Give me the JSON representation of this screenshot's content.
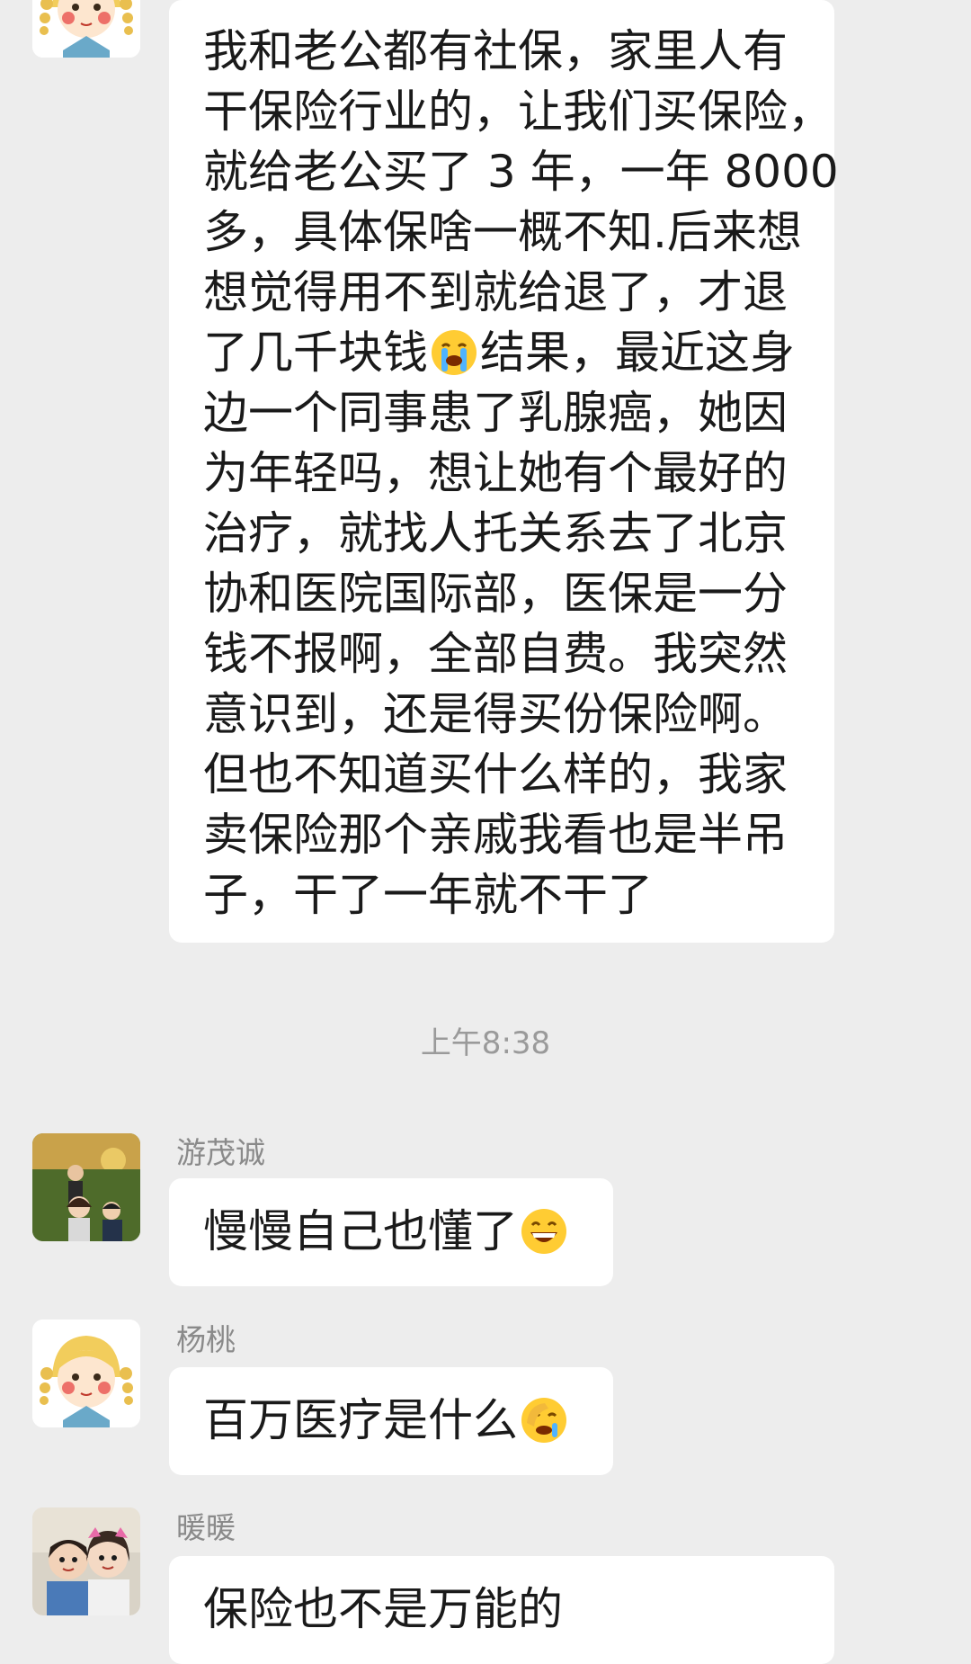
{
  "messages": [
    {
      "sender": "",
      "avatar": "cartoon-girl-avatar",
      "lines": [
        "我和老公都有社保，家里人有",
        "干保险行业的，让我们买保险，",
        "就给老公买了 3 年，一年 8000",
        "多，具体保啥一概不知.后来想",
        "想觉得用不到就给退了，才退",
        "了几千块钱",
        "边一个同事患了乳腺癌，她因",
        "为年轻吗，想让她有个最好的",
        "治疗，就找人托关系去了北京",
        "协和医院国际部，医保是一分",
        "钱不报啊，全部自费。我突然",
        "意识到，还是得买份保险啊。",
        "但也不知道买什么样的，我家",
        "卖保险那个亲戚我看也是半吊",
        "子，干了一年就不干了"
      ],
      "line6_after_emoji": "结果，最近这身",
      "emoji": "loudly-crying-face"
    },
    {
      "sender": "游茂诚",
      "avatar": "family-photo-avatar",
      "text": "慢慢自己也懂了",
      "emoji": "grinning-face"
    },
    {
      "sender": "杨桃",
      "avatar": "cartoon-girl-avatar",
      "text": "百万医疗是什么",
      "emoji": "face-palm-laughing"
    },
    {
      "sender": "暖暖",
      "avatar": "mother-child-photo-avatar",
      "text": "保险也不是万能的"
    }
  ],
  "timestamp": "上午8:38"
}
